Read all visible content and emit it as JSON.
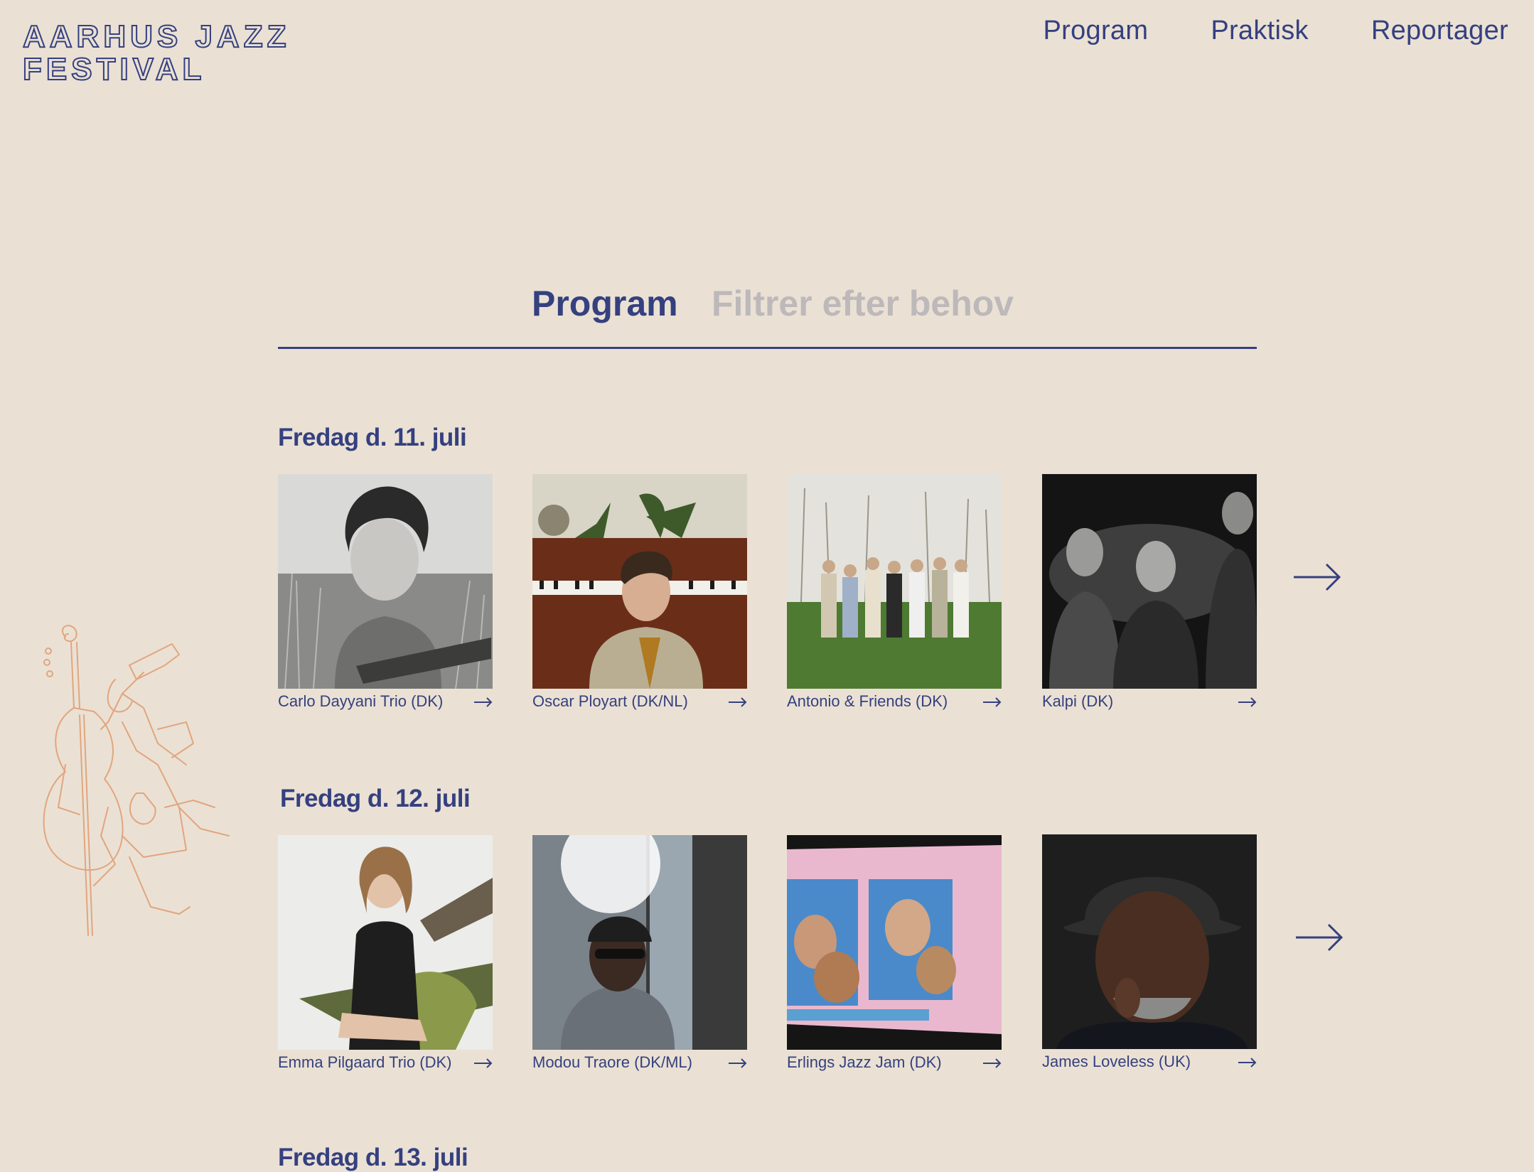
{
  "brand": {
    "logo_line1": "AARHUS JAZZ",
    "logo_line2": "FESTIVAL",
    "primary_color": "#35407F",
    "background_color": "#EAE1D4",
    "illustration_color": "#E2A57E"
  },
  "nav": {
    "items": [
      {
        "label": "Program"
      },
      {
        "label": "Praktisk"
      },
      {
        "label": "Reportager"
      }
    ]
  },
  "tabs": {
    "program": "Program",
    "filter": "Filtrer efter behov"
  },
  "days": [
    {
      "heading": "Fredag d. 11. juli",
      "artists": [
        {
          "name": "Carlo Dayyani Trio (DK)"
        },
        {
          "name": "Oscar Ployart (DK/NL)"
        },
        {
          "name": "Antonio & Friends (DK)"
        },
        {
          "name": "Kalpi (DK)"
        }
      ]
    },
    {
      "heading": "Fredag d. 12. juli",
      "artists": [
        {
          "name": "Emma Pilgaard Trio (DK)"
        },
        {
          "name": "Modou Traore (DK/ML)"
        },
        {
          "name": "Erlings Jazz Jam (DK)"
        },
        {
          "name": "James Loveless (UK)"
        }
      ]
    },
    {
      "heading": "Fredag d. 13. juli",
      "artists": []
    }
  ],
  "icons": {
    "card_arrow": "arrow-right-icon",
    "row_next": "arrow-right-icon",
    "illustration": "jazz-musicians-illustration"
  }
}
